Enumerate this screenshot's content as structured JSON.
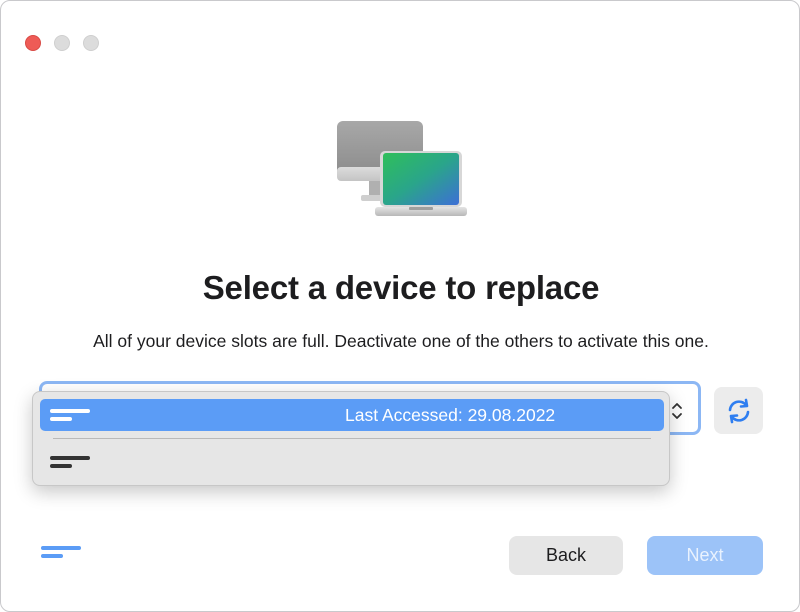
{
  "window": {
    "traffic_lights": [
      "close",
      "minimize",
      "zoom"
    ],
    "colors": {
      "close": "#ee5b56",
      "inactive": "#dcdcdc"
    }
  },
  "hero": {
    "icon": "computer-and-laptop-icon"
  },
  "header": {
    "title": "Select a device to replace",
    "subtitle": "All of your device slots are full. Deactivate one of the others to activate this one."
  },
  "device_select": {
    "options": [
      {
        "label": "Last Accessed: 29.08.2022",
        "selected": true
      },
      {
        "label": "",
        "selected": false
      }
    ],
    "accent_color": "#5b9cf6"
  },
  "refresh_button": {
    "icon": "refresh-icon"
  },
  "footer": {
    "brand_icon": "app-logo-lines-icon",
    "back_label": "Back",
    "next_label": "Next",
    "next_enabled": false
  }
}
